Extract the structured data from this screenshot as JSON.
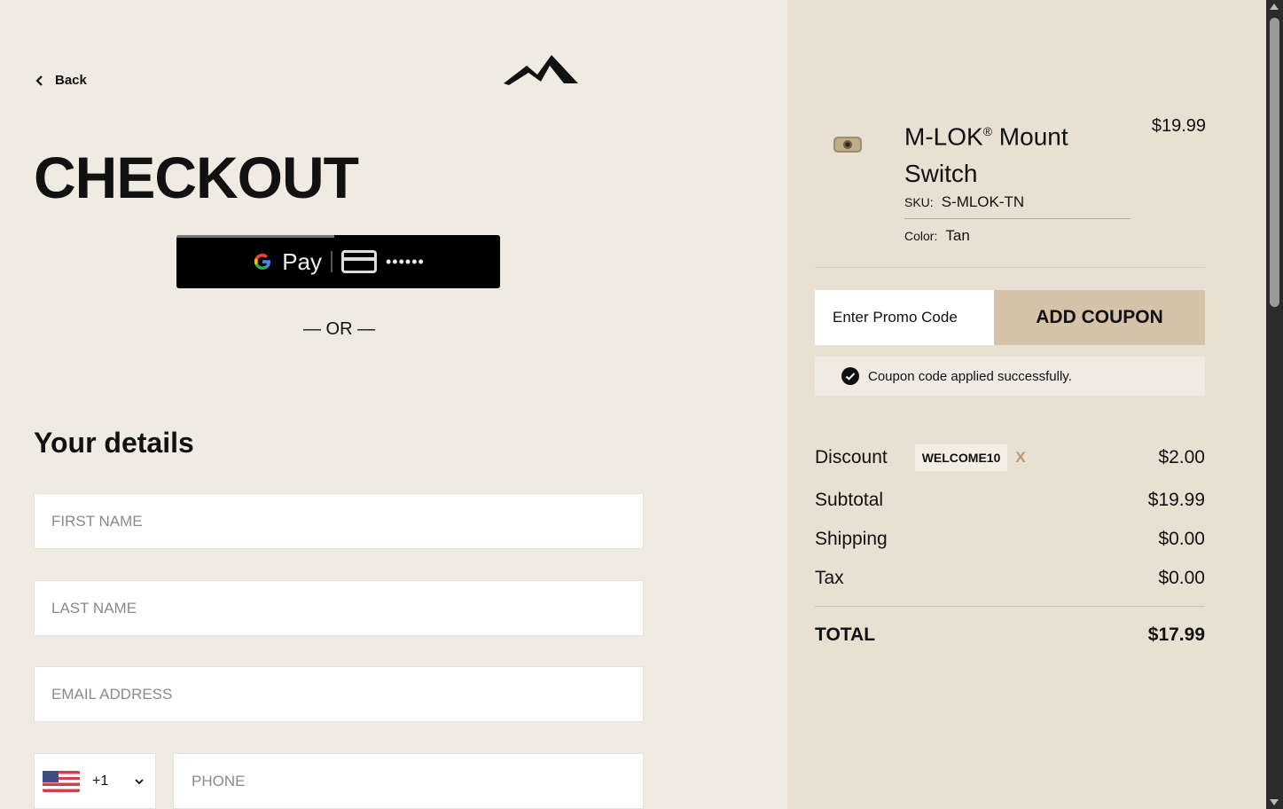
{
  "header": {
    "back_label": "Back",
    "logo_icon": "brand-logo-icon"
  },
  "checkout": {
    "title": "CHECKOUT",
    "gpay": {
      "g_label": "G",
      "pay_label": "Pay",
      "card_dots": "••••••"
    },
    "or_label": "— OR —"
  },
  "details": {
    "heading": "Your details",
    "first_name_placeholder": "FIRST NAME",
    "last_name_placeholder": "LAST NAME",
    "email_placeholder": "EMAIL ADDRESS",
    "country_code": "+1",
    "country_flag_icon": "us-flag-icon",
    "phone_placeholder": "PHONE"
  },
  "cart": {
    "product_name": "M-LOK",
    "product_name_reg": "®",
    "product_name_rest": " Mount Switch",
    "price": "$19.99",
    "sku_label": "SKU:",
    "sku_value": "S-MLOK-TN",
    "color_label": "Color:",
    "color_value": "Tan"
  },
  "coupon": {
    "promo_placeholder": "Enter Promo Code",
    "add_label": "ADD COUPON",
    "success_message": "Coupon code applied successfully."
  },
  "summary": {
    "discount_label": "Discount",
    "discount_code": "WELCOME10",
    "discount_remove": "X",
    "discount_value": "$2.00",
    "subtotal_label": "Subtotal",
    "subtotal_value": "$19.99",
    "shipping_label": "Shipping",
    "shipping_value": "$0.00",
    "tax_label": "Tax",
    "tax_value": "$0.00",
    "total_label": "TOTAL",
    "total_value": "$17.99"
  },
  "colors": {
    "left_bg": "#efebe3",
    "right_bg": "#e8e0d2",
    "coupon_button": "#d4c3a9",
    "accent_remove": "#b9976a"
  }
}
